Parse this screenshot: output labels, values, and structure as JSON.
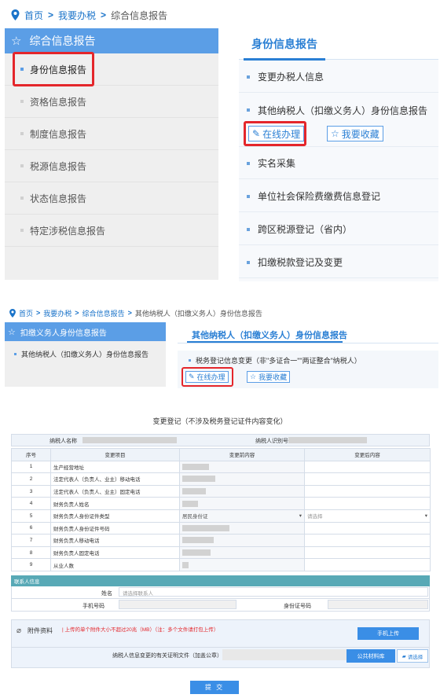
{
  "panel1": {
    "breadcrumb": {
      "home": "首页",
      "sep": ">",
      "tax": "我要办税",
      "current": "综合信息报告"
    },
    "left_title": "综合信息报告",
    "left_items": [
      {
        "label": "身份信息报告"
      },
      {
        "label": "资格信息报告"
      },
      {
        "label": "制度信息报告"
      },
      {
        "label": "税源信息报告"
      },
      {
        "label": "状态信息报告"
      },
      {
        "label": "特定涉税信息报告"
      }
    ],
    "right_tab": "身份信息报告",
    "right_items": [
      {
        "label": "变更办税人信息"
      },
      {
        "label": "其他纳税人（扣缴义务人）身份信息报告"
      },
      {
        "label": "实名采集"
      },
      {
        "label": "单位社会保险费缴费信息登记"
      },
      {
        "label": "跨区税源登记（省内）"
      },
      {
        "label": "扣缴税款登记及变更"
      }
    ],
    "online_btn": "在线办理",
    "favorite_btn": "我要收藏"
  },
  "panel2": {
    "breadcrumb": {
      "home": "首页",
      "sep": ">",
      "tax": "我要办税",
      "mid": "综合信息报告",
      "current": "其他纳税人（扣缴义务人）身份信息报告"
    },
    "left_title": "扣缴义务人身份信息报告",
    "left_item": "其他纳税人（扣缴义务人）身份信息报告",
    "right_tab": "其他纳税人（扣缴义务人）身份信息报告",
    "right_item": "税务登记信息变更（非\"多证合一\"\"两证整合\"纳税人）",
    "online_btn": "在线办理",
    "favorite_btn": "我要收藏"
  },
  "form": {
    "title": "变更登记（不涉及税务登记证件内容变化）",
    "taxpayer_name_label": "纳税人名称",
    "taxpayer_id_label": "纳税人识别号",
    "headers": [
      "序号",
      "变更项目",
      "变更前内容",
      "变更后内容"
    ],
    "rows": [
      {
        "no": "1",
        "item": "生产经营地址"
      },
      {
        "no": "2",
        "item": "法定代表人（负责人、业主）移动电话"
      },
      {
        "no": "3",
        "item": "法定代表人（负责人、业主）固定电话"
      },
      {
        "no": "4",
        "item": "财务负责人姓名"
      },
      {
        "no": "5",
        "item": "财务负责人身份证件类型",
        "before": "居民身份证",
        "after_placeholder": "请选择"
      },
      {
        "no": "6",
        "item": "财务负责人身份证件号码"
      },
      {
        "no": "7",
        "item": "财务负责人移动电话"
      },
      {
        "no": "8",
        "item": "财务负责人固定电话"
      },
      {
        "no": "9",
        "item": "从业人数"
      }
    ],
    "contact_section": "联系人信息",
    "contact_name_label": "姓名",
    "contact_name_placeholder": "请选择联系人",
    "contact_phone_label": "手机号码",
    "contact_id_label": "身份证号码",
    "attach_label": "附件资料",
    "attach_note": "| 上传的单个附件大小不超过20兆（MB）（注：多个文件请打包上传）",
    "mobile_upload_btn": "手机上传",
    "proof_label": "纳税人信息变更的有关证明文件（加盖公章）",
    "public_lib_btn": "公共材料库",
    "choose_btn": "请选择",
    "submit_btn": "提 交"
  }
}
